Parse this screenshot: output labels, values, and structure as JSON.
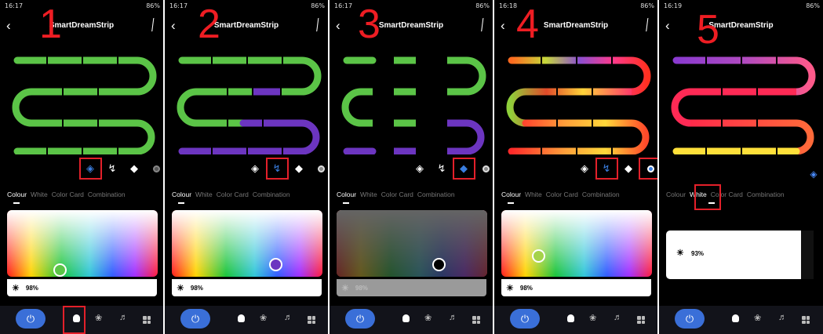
{
  "panels": [
    {
      "number": "1",
      "time": "16:17",
      "status": "86%",
      "title": "SmartDreamStrip",
      "tabs": [
        "Colour",
        "White",
        "Color Card",
        "Combination"
      ],
      "brightness": "98%"
    },
    {
      "number": "2",
      "time": "16:17",
      "status": "86%",
      "title": "SmartDreamStrip",
      "tabs": [
        "Colour",
        "White",
        "Color Card",
        "Combination"
      ],
      "brightness": "98%"
    },
    {
      "number": "3",
      "time": "16:17",
      "status": "86%",
      "title": "SmartDreamStrip",
      "tabs": [
        "Colour",
        "White",
        "Color Card",
        "Combination"
      ],
      "brightness": "98%"
    },
    {
      "number": "4",
      "time": "16:18",
      "status": "86%",
      "title": "SmartDreamStrip",
      "tabs": [
        "Colour",
        "White",
        "Color Card",
        "Combination"
      ],
      "brightness": "98%"
    },
    {
      "number": "5",
      "time": "16:19",
      "status": "86%",
      "title": "SmartDreamStrip",
      "tabs": [
        "Colour",
        "White",
        "Color Card",
        "Combination"
      ],
      "brightness": "93%"
    }
  ],
  "icons": {
    "back": "chevron-left-icon",
    "edit": "pencil-icon",
    "fill": "paint-bucket-icon",
    "pen": "pen-icon",
    "eraser": "eraser-icon",
    "select": "radio-icon",
    "power": "power-icon",
    "bulb": "bulb-icon",
    "palette": "palette-icon",
    "music": "music-icon",
    "grid": "grid-icon",
    "sun": "sun-icon"
  },
  "colors": {
    "highlight": "#e3202a",
    "green": "#5bc447",
    "purple": "#6c35c0",
    "power": "#3a6fd8"
  }
}
